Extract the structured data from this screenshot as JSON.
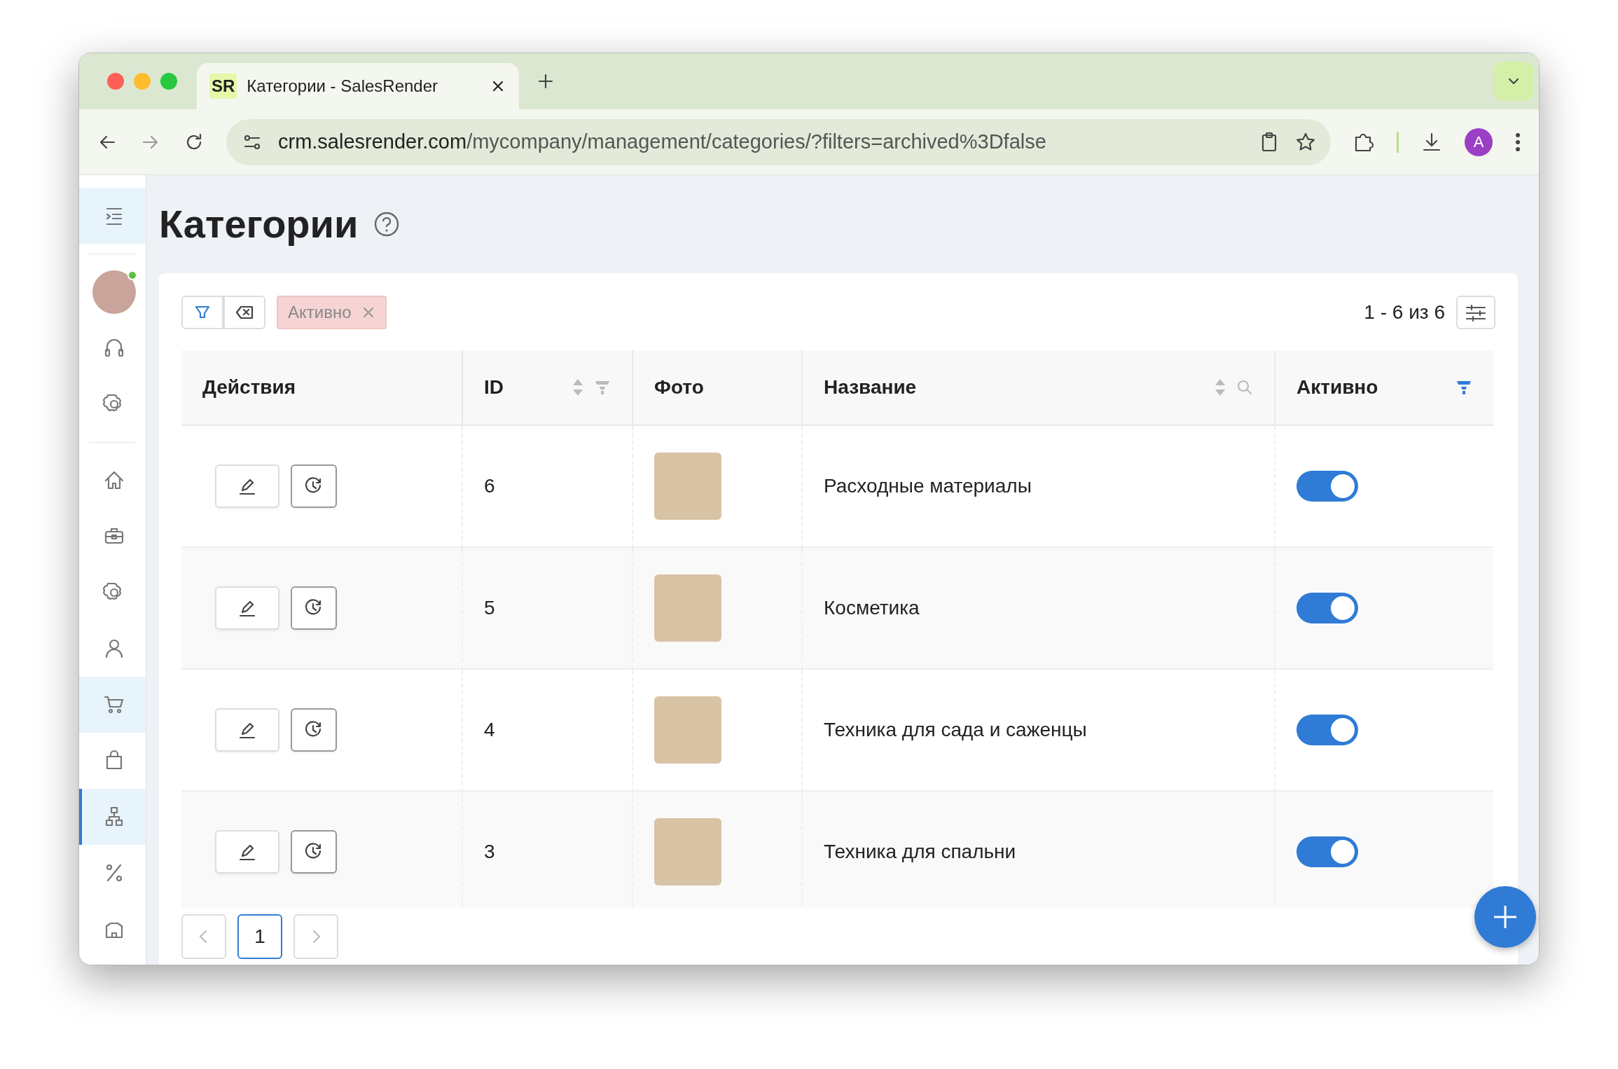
{
  "browser": {
    "tab": {
      "favicon": "SR",
      "title": "Категории - SalesRender",
      "selected": true
    },
    "url": {
      "host": "crm.salesrender.com",
      "path": "/mycompany/management/categories/?filters=archived%3Dfalse"
    },
    "profile": "A"
  },
  "sidebar": {
    "avatar": {
      "online": true
    },
    "top_items": [
      {
        "selected": false
      },
      {
        "selected": false
      }
    ],
    "nav_items": [
      {
        "selected": false,
        "highlighted": false
      },
      {
        "selected": false,
        "highlighted": false
      },
      {
        "selected": false,
        "highlighted": false
      },
      {
        "selected": false,
        "highlighted": false
      },
      {
        "selected": false,
        "highlighted": true
      },
      {
        "selected": false,
        "highlighted": false
      },
      {
        "selected": true,
        "highlighted": true
      },
      {
        "selected": false,
        "highlighted": false
      },
      {
        "selected": false,
        "highlighted": false
      }
    ]
  },
  "page": {
    "title": "Категории"
  },
  "filters": {
    "chips": [
      {
        "label": "Активно"
      }
    ],
    "range": "1 - 6 из 6"
  },
  "table": {
    "columns": [
      {
        "label": "Действия"
      },
      {
        "label": "ID",
        "sortable": true,
        "filterable": true,
        "filter_active": false
      },
      {
        "label": "Фото"
      },
      {
        "label": "Название",
        "sortable": true,
        "searchable": true
      },
      {
        "label": "Активно",
        "filterable": true,
        "filter_active": true
      }
    ],
    "rows": [
      {
        "id": "6",
        "name": "Расходные материалы",
        "active": true
      },
      {
        "id": "5",
        "name": "Косметика",
        "active": true
      },
      {
        "id": "4",
        "name": "Техника для сада и саженцы",
        "active": true
      },
      {
        "id": "3",
        "name": "Техника для спальни",
        "active": true
      }
    ]
  },
  "pagination": {
    "pages": [
      {
        "label": "1",
        "selected": true
      }
    ]
  }
}
